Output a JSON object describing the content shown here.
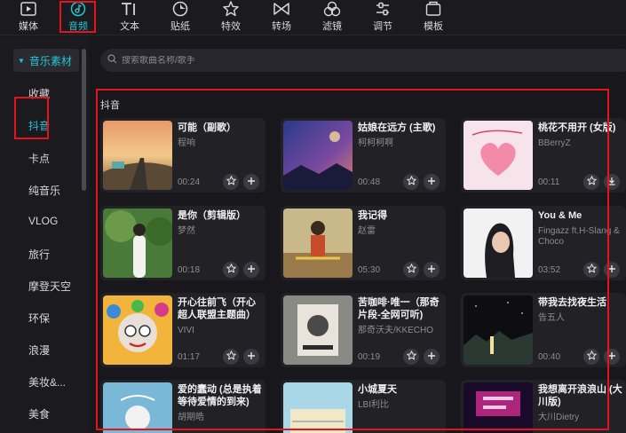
{
  "toolbar": {
    "items": [
      {
        "label": "媒体",
        "icon": "media-play-icon"
      },
      {
        "label": "音频",
        "icon": "audio-icon"
      },
      {
        "label": "文本",
        "icon": "text-icon"
      },
      {
        "label": "贴纸",
        "icon": "sticker-icon"
      },
      {
        "label": "特效",
        "icon": "effects-star-icon"
      },
      {
        "label": "转场",
        "icon": "transition-icon"
      },
      {
        "label": "滤镜",
        "icon": "filter-icon"
      },
      {
        "label": "调节",
        "icon": "adjust-icon"
      },
      {
        "label": "模板",
        "icon": "template-icon"
      }
    ],
    "active": "音频"
  },
  "sidebar": {
    "header": "音乐素材",
    "items": [
      "收藏",
      "抖音",
      "卡点",
      "纯音乐",
      "VLOG",
      "旅行",
      "摩登天空",
      "环保",
      "浪漫",
      "美妆&...",
      "美食"
    ],
    "active": "抖音"
  },
  "search": {
    "placeholder": "搜索歌曲名称/歌手"
  },
  "section": {
    "title": "抖音"
  },
  "songs": [
    {
      "title": "可能（副歌）",
      "artist": "程响",
      "duration": "00:24"
    },
    {
      "title": "姑娘在远方 (主歌)",
      "artist": "柯柯柯啊",
      "duration": "00:48"
    },
    {
      "title": "桃花不用开 (女版)",
      "artist": "BBerryZ",
      "duration": "00:11"
    },
    {
      "title": "是你（剪辑版）",
      "artist": "梦然",
      "duration": "00:18"
    },
    {
      "title": "我记得",
      "artist": "赵雷",
      "duration": "05:30"
    },
    {
      "title": "You & Me",
      "artist": "Fingazz ft.H-Slang & Choco",
      "duration": "03:52"
    },
    {
      "title": "开心往前飞（开心超人联盟主题曲）",
      "artist": "VIVI",
      "duration": "01:17"
    },
    {
      "title": "苦咖啡·唯一（那奇片段-全网可听)",
      "artist": "那奇沃夫/KKECHO",
      "duration": "00:19"
    },
    {
      "title": "带我去找夜生活",
      "artist": "告五人",
      "duration": "00:40"
    },
    {
      "title": "爱的蠢动 (总是执着等待爱情的到来)",
      "artist": "胡期皓",
      "duration": ""
    },
    {
      "title": "小城夏天",
      "artist": "LBI利比",
      "duration": ""
    },
    {
      "title": "我想离开浪浪山 (大川版)",
      "artist": "大川Dietry",
      "duration": ""
    }
  ],
  "colors": {
    "accent": "#23c6d4",
    "highlight_box": "#e3141c",
    "background": "#18181c"
  }
}
